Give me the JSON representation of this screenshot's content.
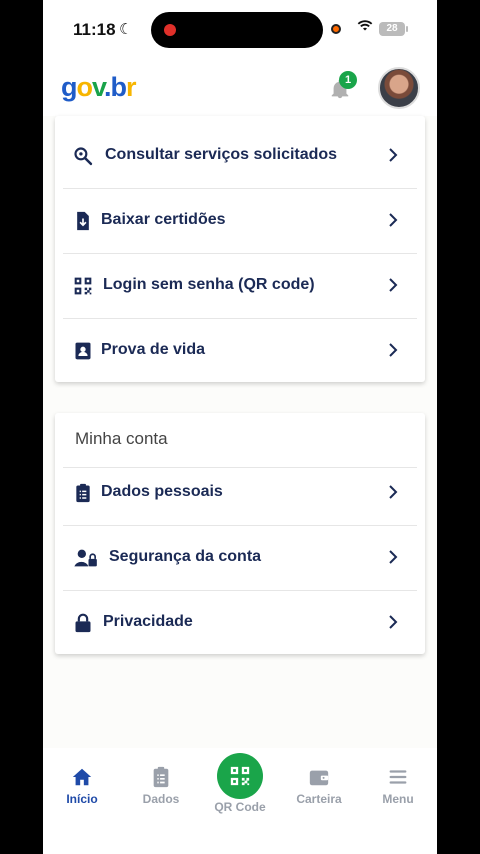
{
  "status_bar": {
    "time": "11:18",
    "battery": "28"
  },
  "app_bar": {
    "logo": {
      "g": "g",
      "o": "o",
      "v": "v",
      "dot": ".",
      "b": "b",
      "r": "r"
    },
    "notification_count": "1"
  },
  "menu_card": {
    "items": [
      {
        "label": "Consultar serviços solicitados",
        "icon": "search-zoom-icon"
      },
      {
        "label": "Baixar certidões",
        "icon": "file-download-icon"
      },
      {
        "label": "Login sem senha (QR code)",
        "icon": "qrcode-icon"
      },
      {
        "label": "Prova de vida",
        "icon": "id-badge-icon"
      }
    ]
  },
  "account_card": {
    "title": "Minha conta",
    "items": [
      {
        "label": "Dados pessoais",
        "icon": "clipboard-list-icon"
      },
      {
        "label": "Segurança da conta",
        "icon": "user-lock-icon"
      },
      {
        "label": "Privacidade",
        "icon": "lock-icon"
      }
    ]
  },
  "tab_bar": {
    "tabs": [
      {
        "label": "Início",
        "icon": "home-icon",
        "active": true
      },
      {
        "label": "Dados",
        "icon": "clipboard-icon"
      },
      {
        "label": "QR Code",
        "icon": "qrcode-icon"
      },
      {
        "label": "Carteira",
        "icon": "wallet-icon"
      },
      {
        "label": "Menu",
        "icon": "hamburger-icon"
      }
    ]
  },
  "colors": {
    "primary": "#1b2a55",
    "accent_green": "#1aa54a",
    "active_tab": "#1f4aa8"
  }
}
